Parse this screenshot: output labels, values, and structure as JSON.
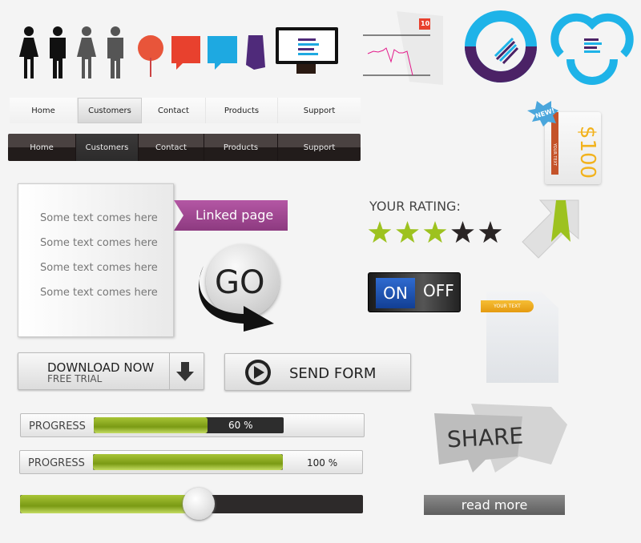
{
  "icons": {
    "people": [
      "woman-icon",
      "man-icon",
      "woman-gray-icon",
      "man-gray-icon"
    ],
    "pin_color": "#e8553a",
    "speech_red": "#e8412e",
    "speech_blue": "#1ea9e1",
    "tie_purple": "#4f2a7a"
  },
  "chart_badge": "10",
  "nav_light": {
    "items": [
      "Home",
      "Customers",
      "Contact",
      "Products",
      "Support"
    ],
    "active": "Customers"
  },
  "nav_dark": {
    "items": [
      "Home",
      "Customers",
      "Contact",
      "Products",
      "Support"
    ],
    "active": "Customers"
  },
  "price_tag": {
    "badge": "NEW!",
    "ribbon": "YOUR TEXT",
    "price": "$100"
  },
  "list_panel": {
    "items": [
      "Some text comes here",
      "Some text comes here",
      "Some text comes here",
      "Some text comes here"
    ],
    "link": "Linked page"
  },
  "go_button": "GO",
  "rating": {
    "label": "YOUR RATING:",
    "value": 3,
    "max": 5,
    "color_on": "#9dc21f",
    "color_off": "#2a2525"
  },
  "toggle": {
    "on": "ON",
    "off": "OFF",
    "state": "on"
  },
  "note": {
    "label": "YOUR TEXT"
  },
  "download": {
    "title": "DOWNLOAD NOW",
    "subtitle": "FREE TRIAL"
  },
  "send_form": "SEND FORM",
  "progress": [
    {
      "label": "PROGRESS",
      "value": 60,
      "text": "60 %"
    },
    {
      "label": "PROGRESS",
      "value": 100,
      "text": "100 %"
    }
  ],
  "slider": {
    "value": 52
  },
  "share": "SHARE",
  "read_more": "read more"
}
